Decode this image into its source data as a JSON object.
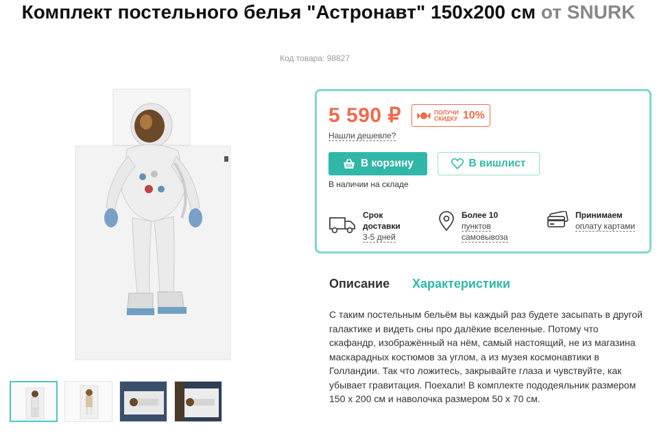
{
  "product": {
    "title_main": "Комплект постельного белья \"Астронавт\" 150x200 см",
    "title_brand": "от SNURK",
    "sku": "Код товара: 98827"
  },
  "gallery": {
    "thumbnails": [
      "thumb-1",
      "thumb-2",
      "thumb-3",
      "thumb-4"
    ],
    "active_index": 0
  },
  "buy_box": {
    "price": "5 590 ₽",
    "discount_line1": "получи",
    "discount_line2": "скидку",
    "discount_value": "10%",
    "found_cheaper": "Нашли дешевле?",
    "cart_button": "В корзину",
    "wishlist_button": "В вишлист",
    "stock_status": "В наличии на складе",
    "features": [
      {
        "icon": "truck-icon",
        "label_line1": "Срок",
        "label_line2": "доставки",
        "link": "3-5 дней"
      },
      {
        "icon": "map-pin-icon",
        "label_line1": "Более 10",
        "link_line1": "пунктов",
        "link_line2": "самовывоза"
      },
      {
        "icon": "credit-card-icon",
        "label_line1": "Принимаем",
        "link": "оплату картами"
      }
    ],
    "accent_color": "#31b7a8",
    "price_color": "#f06a4e"
  },
  "tabs": [
    {
      "label": "Описание",
      "active": true
    },
    {
      "label": "Характеристики",
      "active": false
    }
  ],
  "description": "С таким постельным бельём вы каждый раз будете засыпать в другой галактике и видеть сны про далёкие вселенные. Потому что скафандр, изображённый на нём, самый настоящий, не из магазина маскарадных костюмов за углом, а из музея космонавтики в Голландии. Так что ложитесь, закрывайте глаза и чувствуйте, как убывает гравитация. Поехали! В комплекте пододеяльник размером 150 х 200 см и наволочка размером 50 х 70 см."
}
